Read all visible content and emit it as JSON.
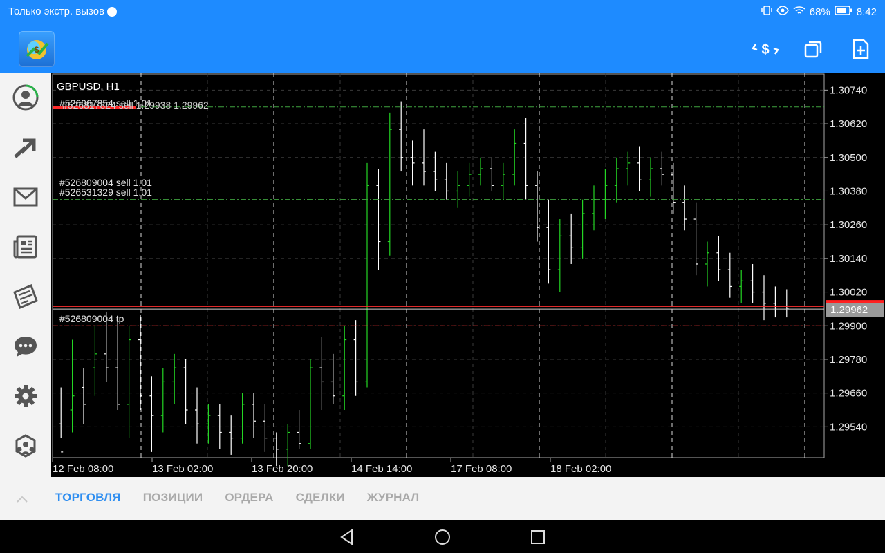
{
  "status_bar": {
    "carrier": "Только экстр. вызов",
    "battery": "68%",
    "time": "8:42"
  },
  "app_bar": {
    "icons": [
      "app-logo",
      "trade-exchange-icon",
      "windows-icon",
      "new-order-icon"
    ]
  },
  "sidebar": {
    "items": [
      "account-icon",
      "trade-icon",
      "mail-icon",
      "news-icon",
      "tag-icon",
      "chat-icon",
      "settings-icon",
      "community-icon"
    ]
  },
  "chart": {
    "symbol_label": "GBPUSD, H1",
    "bid_price": "1.29962",
    "order_labels": {
      "top": "#526067854 sell 1.01",
      "top_overlap": "#526317824 sell 1.29938 1.29962",
      "mid1": "#526809004 sell 1.01",
      "mid2": "#526531329 sell 1.01",
      "tp": "#526809004 tp",
      "tp_overlap": "#526809004"
    },
    "colors": {
      "bull": "#24d624",
      "bear": "#ffffff",
      "bid_line": "#ff3030",
      "order_line": "#3fa33f",
      "grid": "#3a3a3a",
      "accent": "#2f8ef0"
    }
  },
  "chart_data": {
    "type": "candlestick",
    "title": "GBPUSD, H1",
    "y_ticks": [
      "1.30740",
      "1.30620",
      "1.30500",
      "1.30380",
      "1.30260",
      "1.30140",
      "1.30020",
      "1.29900",
      "1.29780",
      "1.29660",
      "1.29540"
    ],
    "x_ticks": [
      "12 Feb 08:00",
      "13 Feb 02:00",
      "13 Feb 20:00",
      "14 Feb 14:00",
      "17 Feb 08:00",
      "18 Feb 02:00"
    ],
    "ylim": [
      1.2943,
      1.308
    ],
    "last_price": 1.29962,
    "order_levels": [
      {
        "price": 1.3068,
        "style": "green-dashdot"
      },
      {
        "price": 1.3038,
        "style": "green-dashdot"
      },
      {
        "price": 1.3035,
        "style": "green-dashdot"
      },
      {
        "price": 1.299,
        "style": "red-dashdot"
      }
    ],
    "candles": [
      [
        1.2955,
        1.2968,
        1.295,
        1.2945
      ],
      [
        1.296,
        1.2985,
        1.2952,
        1.2965
      ],
      [
        1.2968,
        1.2975,
        1.2955,
        1.2962
      ],
      [
        1.2975,
        1.299,
        1.2965,
        1.298
      ],
      [
        1.298,
        1.2995,
        1.297,
        1.2975
      ],
      [
        1.2975,
        1.2993,
        1.296,
        1.2962
      ],
      [
        1.2962,
        1.299,
        1.295,
        1.2985
      ],
      [
        1.2985,
        1.2994,
        1.296,
        1.2965
      ],
      [
        1.2965,
        1.2972,
        1.2945,
        1.2958
      ],
      [
        1.2958,
        1.2975,
        1.2952,
        1.297
      ],
      [
        1.297,
        1.298,
        1.2962,
        1.2975
      ],
      [
        1.2975,
        1.2978,
        1.2955,
        1.296
      ],
      [
        1.296,
        1.2968,
        1.2948,
        1.2955
      ],
      [
        1.2955,
        1.2962,
        1.2948,
        1.2958
      ],
      [
        1.2958,
        1.2962,
        1.2946,
        1.2952
      ],
      [
        1.2952,
        1.2958,
        1.2944,
        1.295
      ],
      [
        1.295,
        1.2966,
        1.2948,
        1.2962
      ],
      [
        1.2962,
        1.2966,
        1.295,
        1.2956
      ],
      [
        1.2956,
        1.2962,
        1.2945,
        1.295
      ],
      [
        1.295,
        1.2952,
        1.294,
        1.2946
      ],
      [
        1.2946,
        1.2955,
        1.294,
        1.2952
      ],
      [
        1.2952,
        1.296,
        1.2946,
        1.2948
      ],
      [
        1.2948,
        1.2978,
        1.2946,
        1.2975
      ],
      [
        1.2975,
        1.2986,
        1.296,
        1.297
      ],
      [
        1.297,
        1.298,
        1.2962,
        1.2965
      ],
      [
        1.2965,
        1.299,
        1.296,
        1.2985
      ],
      [
        1.2985,
        1.2992,
        1.2965,
        1.297
      ],
      [
        1.297,
        1.3048,
        1.2968,
        1.304
      ],
      [
        1.304,
        1.3046,
        1.301,
        1.302
      ],
      [
        1.302,
        1.3066,
        1.3015,
        1.306
      ],
      [
        1.306,
        1.307,
        1.3045,
        1.305
      ],
      [
        1.305,
        1.3056,
        1.304,
        1.3048
      ],
      [
        1.3048,
        1.306,
        1.304,
        1.3045
      ],
      [
        1.3045,
        1.3052,
        1.3038,
        1.3042
      ],
      [
        1.3042,
        1.3048,
        1.3035,
        1.3038
      ],
      [
        1.3038,
        1.3045,
        1.3032,
        1.304
      ],
      [
        1.304,
        1.3048,
        1.3036,
        1.3044
      ],
      [
        1.3044,
        1.305,
        1.304,
        1.3046
      ],
      [
        1.3046,
        1.305,
        1.3038,
        1.304
      ],
      [
        1.304,
        1.3048,
        1.3035,
        1.3044
      ],
      [
        1.3044,
        1.306,
        1.304,
        1.3055
      ],
      [
        1.3055,
        1.3064,
        1.3035,
        1.304
      ],
      [
        1.304,
        1.3045,
        1.302,
        1.3025
      ],
      [
        1.3025,
        1.3035,
        1.3005,
        1.301
      ],
      [
        1.301,
        1.3028,
        1.3002,
        1.3022
      ],
      [
        1.3022,
        1.303,
        1.3012,
        1.3018
      ],
      [
        1.3018,
        1.3035,
        1.3014,
        1.303
      ],
      [
        1.303,
        1.304,
        1.3024,
        1.3035
      ],
      [
        1.3035,
        1.3046,
        1.3028,
        1.304
      ],
      [
        1.304,
        1.305,
        1.3034,
        1.3046
      ],
      [
        1.3046,
        1.3052,
        1.304,
        1.3048
      ],
      [
        1.3048,
        1.3054,
        1.3038,
        1.3042
      ],
      [
        1.3042,
        1.305,
        1.3036,
        1.3046
      ],
      [
        1.3046,
        1.3052,
        1.304,
        1.3044
      ],
      [
        1.3044,
        1.3048,
        1.303,
        1.3034
      ],
      [
        1.3034,
        1.304,
        1.3024,
        1.3028
      ],
      [
        1.3028,
        1.3034,
        1.3008,
        1.3012
      ],
      [
        1.3012,
        1.302,
        1.3004,
        1.3016
      ],
      [
        1.3016,
        1.3022,
        1.3006,
        1.301
      ],
      [
        1.301,
        1.3016,
        1.3,
        1.3004
      ],
      [
        1.3004,
        1.301,
        1.2998,
        1.3006
      ],
      [
        1.3006,
        1.3012,
        1.2998,
        1.3002
      ],
      [
        1.3002,
        1.3008,
        1.2992,
        1.2998
      ],
      [
        1.2998,
        1.3004,
        1.2993,
        1.2997
      ],
      [
        1.2997,
        1.3003,
        1.2993,
        1.2996
      ]
    ]
  },
  "bottom_bar": {
    "tabs": [
      {
        "label": "ТОРГОВЛЯ",
        "active": true
      },
      {
        "label": "ПОЗИЦИИ",
        "active": false
      },
      {
        "label": "ОРДЕРА",
        "active": false
      },
      {
        "label": "СДЕЛКИ",
        "active": false
      },
      {
        "label": "ЖУРНАЛ",
        "active": false
      }
    ]
  },
  "nav_bar": {
    "icons": [
      "back-icon",
      "home-icon",
      "recents-icon"
    ]
  }
}
